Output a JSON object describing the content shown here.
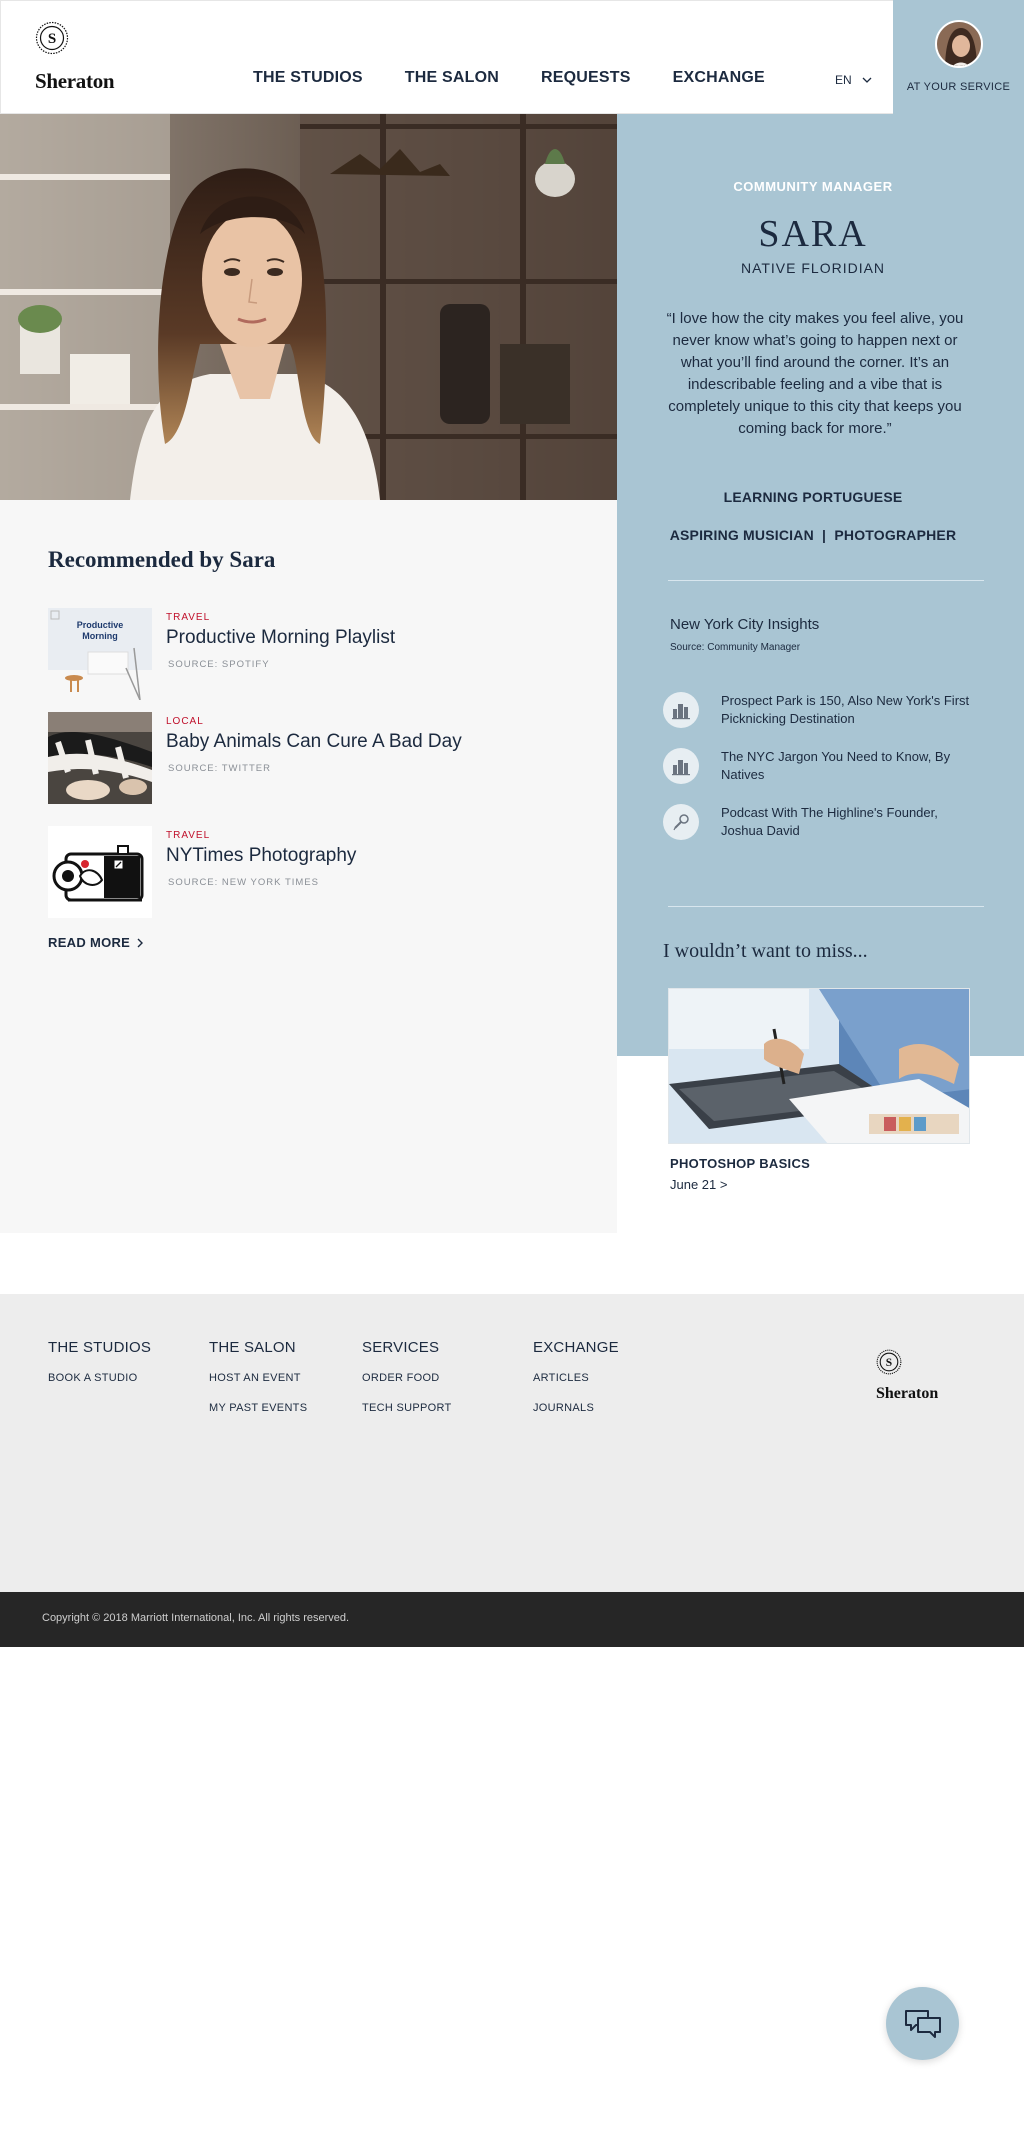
{
  "brand": {
    "name": "Sheraton",
    "seal_letter": "S"
  },
  "nav": {
    "items": [
      "THE STUDIOS",
      "THE SALON",
      "REQUESTS",
      "EXCHANGE"
    ]
  },
  "language": {
    "selected": "EN"
  },
  "service": {
    "label": "AT YOUR SERVICE"
  },
  "profile": {
    "role": "COMMUNITY MANAGER",
    "name": "SARA",
    "origin": "NATIVE FLORIDIAN",
    "quote": "“I love how the city makes you feel alive, you never know what’s going to happen next or what you’ll find around the corner.  It’s an indescribable feeling and a vibe that is completely unique to this city that keeps you coming back for more.”",
    "interest_1": "LEARNING PORTUGUESE",
    "interest_2": "ASPIRING MUSICIAN  |  PHOTOGRAPHER"
  },
  "insights": {
    "title": "New York City Insights",
    "source": "Source: Community Manager",
    "items": [
      {
        "text": "Prospect Park is 150, Also New York's First Picknicking Destination",
        "icon": "city-icon"
      },
      {
        "text": "The NYC Jargon You Need to Know, By Natives",
        "icon": "city-icon"
      },
      {
        "text": "Podcast With The Highline's Founder, Joshua David",
        "icon": "microphone-icon"
      }
    ]
  },
  "miss": {
    "title": "I wouldn’t want to miss...",
    "event_title": "PHOTOSHOP BASICS",
    "event_date": "June 21 >"
  },
  "recommendations": {
    "title": "Recommended by Sara",
    "items": [
      {
        "category": "TRAVEL",
        "title": "Productive Morning Playlist",
        "source": "SOURCE: SPOTIFY",
        "thumb_text": "Productive Morning"
      },
      {
        "category": "LOCAL",
        "title": "Baby Animals Can Cure A Bad Day",
        "source": "SOURCE: TWITTER"
      },
      {
        "category": "TRAVEL",
        "title": "NYTimes Photography",
        "source": "SOURCE: NEW YORK TIMES"
      }
    ],
    "read_more": "READ MORE"
  },
  "footer": {
    "columns": [
      {
        "heading": "THE STUDIOS",
        "links": [
          "BOOK A STUDIO"
        ]
      },
      {
        "heading": "THE SALON",
        "links": [
          "HOST AN EVENT",
          "MY PAST EVENTS"
        ]
      },
      {
        "heading": "SERVICES",
        "links": [
          "ORDER FOOD",
          "TECH SUPPORT"
        ]
      },
      {
        "heading": "EXCHANGE",
        "links": [
          "ARTICLES",
          "JOURNALS"
        ]
      }
    ],
    "copyright": "Copyright © 2018 Marriott International, Inc. All rights reserved."
  },
  "colors": {
    "accent": "#a9c5d3",
    "navy": "#1c2a3f",
    "category_red": "#c0102b",
    "footer_bg": "#ededed",
    "copyright_bg": "#262626"
  }
}
